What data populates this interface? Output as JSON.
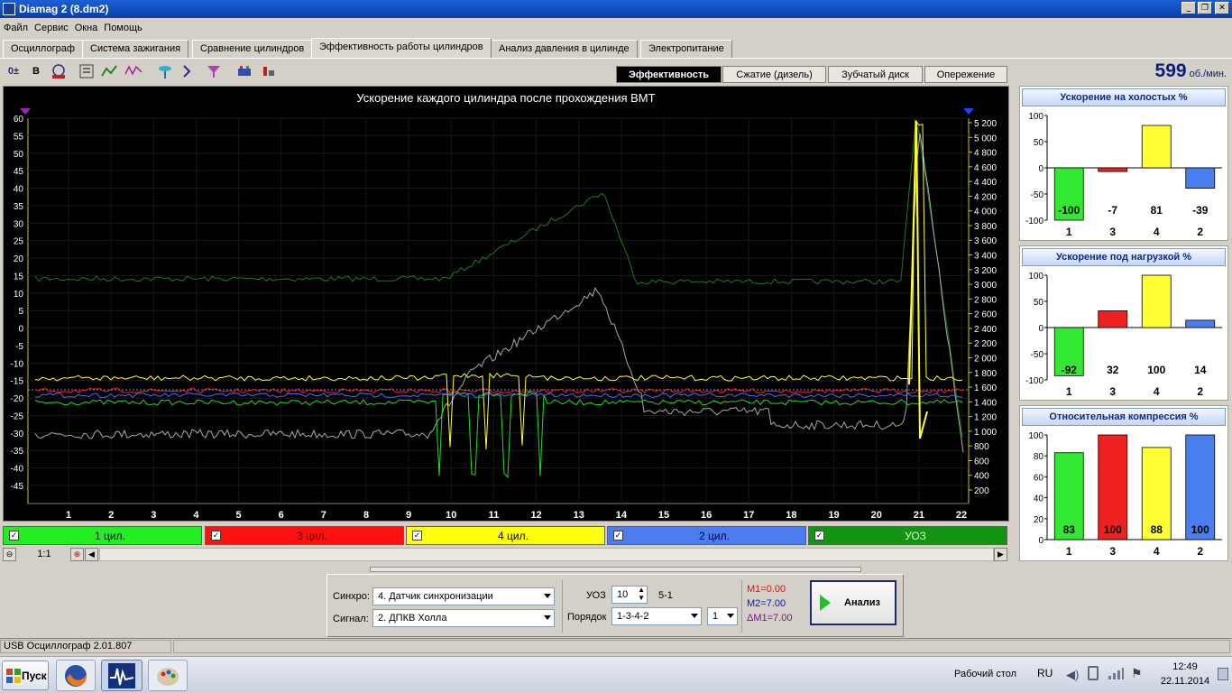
{
  "window": {
    "title": "Diamag 2 (8.dm2)",
    "controls": [
      "_",
      "❐",
      "✕"
    ]
  },
  "menu": [
    "Файл",
    "Сервис",
    "Окна",
    "Помощь"
  ],
  "tabs": [
    "Осциллограф",
    "Система зажигания",
    "Сравнение цилиндров",
    "Эффективность работы цилиндров",
    "Анализ давления в цилинде",
    "Электропитание"
  ],
  "active_tab": 3,
  "toolbar": [
    "trigger-icon",
    "bold-icon",
    "rpm-icon",
    "order-icon",
    "curve-icon",
    "vvti-icon",
    "sensor-icon",
    "cylinder-order-icon",
    "filter-icon",
    "engine-icon",
    "settings-icon"
  ],
  "subtabs": [
    "Эффективность",
    "Сжатие (дизель)",
    "Зубчатый диск",
    "Опережение"
  ],
  "rpm": {
    "value": "599",
    "unit": "об./мин."
  },
  "chart": {
    "title": "Ускорение каждого цилиндра после прохождения ВМТ",
    "left_ticks": [
      "60",
      "55",
      "50",
      "45",
      "40",
      "35",
      "30",
      "25",
      "20",
      "15",
      "10",
      "5",
      "0",
      "-5",
      "-10",
      "-15",
      "-20",
      "-25",
      "-30",
      "-35",
      "-40",
      "-45"
    ],
    "right_ticks": [
      "5 200",
      "5 000",
      "4 800",
      "4 600",
      "4 400",
      "4 200",
      "4 000",
      "3 800",
      "3 600",
      "3 400",
      "3 200",
      "3 000",
      "2 800",
      "2 600",
      "2 400",
      "2 200",
      "2 000",
      "1 800",
      "1 600",
      "1 400",
      "1 200",
      "1 000",
      "800",
      "600",
      "400",
      "200"
    ],
    "x_ticks": [
      "1",
      "2",
      "3",
      "4",
      "5",
      "6",
      "7",
      "8",
      "9",
      "10",
      "11",
      "12",
      "13",
      "14",
      "15",
      "16",
      "17",
      "18",
      "19",
      "20",
      "21",
      "22"
    ],
    "series_colors": {
      "cyl1": "#22dd22",
      "cyl3": "#ff2020",
      "cyl4": "#ffff30",
      "cyl2": "#4a6cff",
      "uoz": "#1b7d1b",
      "gray": "#a8a8a8"
    }
  },
  "legend": [
    {
      "label": "1 цил.",
      "color": "#22ee22",
      "text": "#000000"
    },
    {
      "label": "3 цил.",
      "color": "#ff1010",
      "text": "#6a0000"
    },
    {
      "label": "4 цил.",
      "color": "#ffff10",
      "text": "#000000"
    },
    {
      "label": "2 цил.",
      "color": "#4a7df0",
      "text": "#000040"
    },
    {
      "label": "УОЗ",
      "color": "#139413",
      "text": "#d0ffd0"
    }
  ],
  "zoom": {
    "label": "1:1"
  },
  "bar_panels": [
    {
      "title": "Ускорение на холостых %",
      "ticks": [
        "100",
        "50",
        "0",
        "-50",
        "-100"
      ],
      "range": [
        -100,
        100
      ],
      "bars": [
        {
          "cyl": "1",
          "value": -100,
          "color": "#33e833"
        },
        {
          "cyl": "3",
          "value": -7,
          "color": "#ee2020"
        },
        {
          "cyl": "4",
          "value": 81,
          "color": "#ffff33"
        },
        {
          "cyl": "2",
          "value": -39,
          "color": "#4a7df0"
        }
      ],
      "labels": [
        "-100",
        "-7",
        "81",
        "-39"
      ]
    },
    {
      "title": "Ускорение под нагрузкой %",
      "ticks": [
        "100",
        "50",
        "0",
        "-50",
        "-100"
      ],
      "range": [
        -100,
        100
      ],
      "bars": [
        {
          "cyl": "1",
          "value": -92,
          "color": "#33e833"
        },
        {
          "cyl": "3",
          "value": 32,
          "color": "#ee2020"
        },
        {
          "cyl": "4",
          "value": 100,
          "color": "#ffff33"
        },
        {
          "cyl": "2",
          "value": 14,
          "color": "#4a7df0"
        }
      ],
      "labels": [
        "-92",
        "32",
        "100",
        "14"
      ]
    },
    {
      "title": "Относительная компрессия %",
      "ticks": [
        "100",
        "80",
        "60",
        "40",
        "20",
        "0"
      ],
      "range": [
        0,
        100
      ],
      "bars": [
        {
          "cyl": "1",
          "value": 83,
          "color": "#33e833"
        },
        {
          "cyl": "3",
          "value": 100,
          "color": "#ee2020"
        },
        {
          "cyl": "4",
          "value": 88,
          "color": "#ffff33"
        },
        {
          "cyl": "2",
          "value": 100,
          "color": "#4a7df0"
        }
      ],
      "labels": [
        "83",
        "100",
        "88",
        "100"
      ]
    }
  ],
  "controls": {
    "sync_label": "Синхро:",
    "sync_value": "4.  Датчик синхронизации",
    "signal_label": "Сигнал:",
    "signal_value": "2.  ДПКВ Холла",
    "uoz_label": "УОЗ",
    "uoz_value": "10",
    "uoz_ratio": "5-1",
    "order_label": "Порядок",
    "order_value": "1-3-4-2",
    "order_extra": "1",
    "m1": "M1=0.00",
    "m2": "M2=7.00",
    "dm1": "ΔM1=7.00",
    "analyze": "Анализ"
  },
  "status": {
    "text": "USB Осциллограф   2.01.807"
  },
  "taskbar": {
    "start": "Пуск",
    "desktop": "Рабочий стол",
    "lang": "RU",
    "time": "12:49",
    "date": "22.11.2014"
  }
}
